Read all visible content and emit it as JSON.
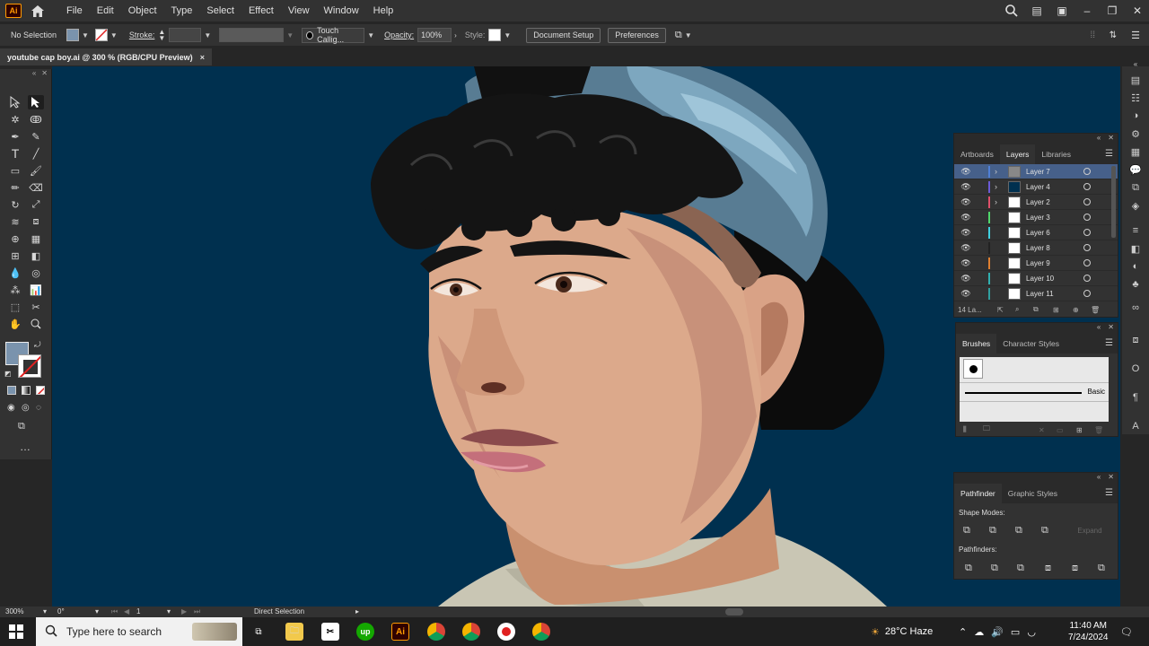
{
  "app": {
    "logo": "Ai"
  },
  "menu": [
    "File",
    "Edit",
    "Object",
    "Type",
    "Select",
    "Effect",
    "View",
    "Window",
    "Help"
  ],
  "control": {
    "selection": "No Selection",
    "stroke_label": "Stroke:",
    "brush": "Touch Callig...",
    "opacity_label": "Opacity:",
    "opacity_value": "100%",
    "style_label": "Style:",
    "document_setup": "Document Setup",
    "preferences": "Preferences"
  },
  "document_tab": {
    "title": "youtube cap boy.ai @ 300 % (RGB/CPU Preview)",
    "close": "×"
  },
  "layers_panel": {
    "tabs": [
      "Artboards",
      "Layers",
      "Libraries"
    ],
    "active_tab": "Layers",
    "layers": [
      {
        "name": "Layer 7",
        "color": "#4f7fd6",
        "selected": true,
        "expandable": true
      },
      {
        "name": "Layer 4",
        "color": "#6b5ad6",
        "selected": false,
        "expandable": true
      },
      {
        "name": "Layer 2",
        "color": "#e0506a",
        "selected": false,
        "expandable": true
      },
      {
        "name": "Layer 3",
        "color": "#4fd66a",
        "selected": false,
        "expandable": false
      },
      {
        "name": "Layer 6",
        "color": "#40d0e0",
        "selected": false,
        "expandable": false
      },
      {
        "name": "Layer 8",
        "color": "#222222",
        "selected": false,
        "expandable": false
      },
      {
        "name": "Layer 9",
        "color": "#e08030",
        "selected": false,
        "expandable": false
      },
      {
        "name": "Layer 10",
        "color": "#30b0b0",
        "selected": false,
        "expandable": false
      },
      {
        "name": "Layer 11",
        "color": "#30a0a0",
        "selected": false,
        "expandable": false
      }
    ],
    "footer_count": "14 La..."
  },
  "brushes_panel": {
    "tabs": [
      "Brushes",
      "Character Styles"
    ],
    "active_tab": "Brushes",
    "brush_name": "Basic"
  },
  "pathfinder_panel": {
    "tabs": [
      "Pathfinder",
      "Graphic Styles"
    ],
    "active_tab": "Pathfinder",
    "shape_modes_label": "Shape Modes:",
    "pathfinders_label": "Pathfinders:",
    "expand": "Expand"
  },
  "status": {
    "zoom": "300%",
    "rotation": "0°",
    "artboard": "1",
    "tool": "Direct Selection"
  },
  "taskbar": {
    "search_placeholder": "Type here to search",
    "weather": "28°C  Haze",
    "time": "11:40 AM",
    "date": "7/24/2024"
  },
  "colors": {
    "canvas_bg": "#00304f",
    "fill_swatch": "#7a93ad",
    "ui_bg": "#323232",
    "selection": "#46608a"
  }
}
